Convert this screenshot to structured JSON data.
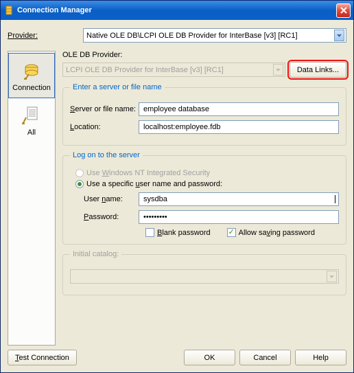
{
  "titlebar": {
    "title": "Connection Manager"
  },
  "provider": {
    "label": "Provider:",
    "value": "Native OLE DB\\LCPI OLE DB Provider for InterBase [v3] [RC1]"
  },
  "tabs": {
    "connection": "Connection",
    "all": "All"
  },
  "ole": {
    "label": "OLE DB Provider:",
    "value": "LCPI OLE DB Provider for InterBase [v3] [RC1]",
    "data_links": "Data Links..."
  },
  "server_group": {
    "legend": "Enter a server or file name",
    "server_label": "Server or file name:",
    "server_value": "employee database",
    "location_label": "Location:",
    "location_value": "localhost:employee.fdb"
  },
  "logon_group": {
    "legend": "Log on to the server",
    "nt_label": "Use Windows NT Integrated Security",
    "specific_label": "Use a specific user name and password:",
    "user_label": "User name:",
    "user_value": "sysdba",
    "pass_label": "Password:",
    "pass_value": "•••••••••",
    "blank_label": "Blank password",
    "allow_label": "Allow saving password"
  },
  "catalog_group": {
    "legend": "Initial catalog:"
  },
  "footer": {
    "test": "Test Connection",
    "ok": "OK",
    "cancel": "Cancel",
    "help": "Help"
  }
}
